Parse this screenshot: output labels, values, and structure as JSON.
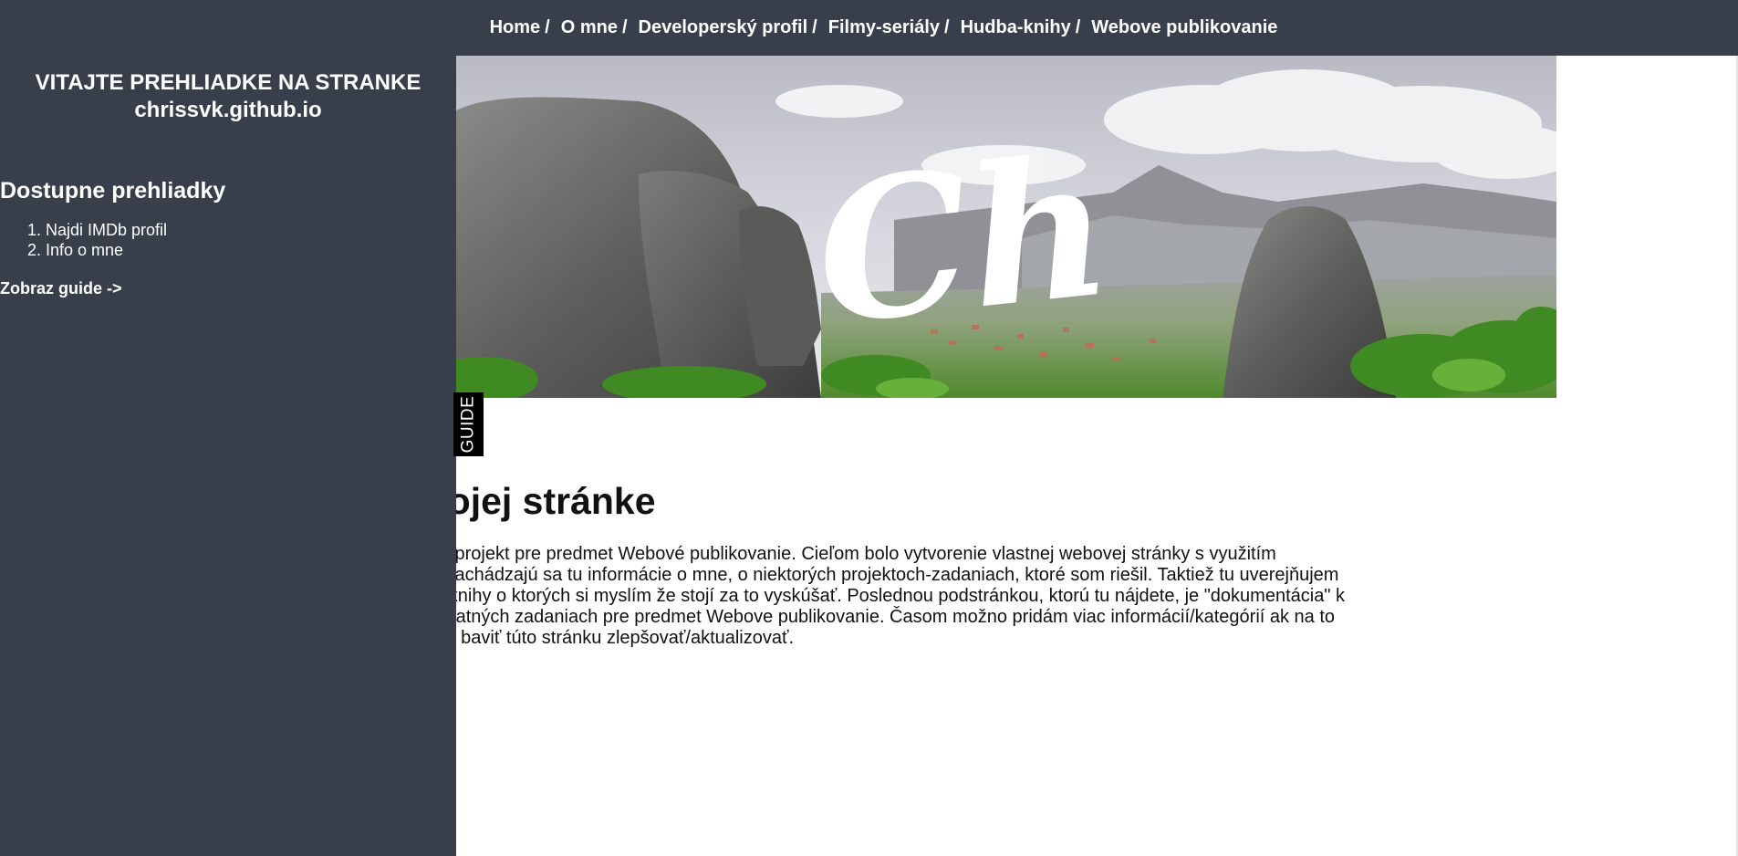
{
  "nav": {
    "items": [
      {
        "label": "Home"
      },
      {
        "label": "O mne"
      },
      {
        "label": "Developerský profil"
      },
      {
        "label": "Filmy-seriály"
      },
      {
        "label": "Hudba-knihy"
      },
      {
        "label": "Webove publikovanie"
      }
    ],
    "separator": "/"
  },
  "banner": {
    "logo_text": "Ch"
  },
  "main": {
    "heading": "a mojej stránke",
    "intro_lines": [
      "a ako projekt pre predmet Webové publikovanie. Cieľom bolo vytvorenie vlastnej webovej stránky s využitím",
      "kyll. Nachádzajú sa tu informácie o mne, o niektorých projektoch-zadaniach, ktoré som riešil. Taktiež tu uverejňujem",
      "ály a knihy o ktorých si myslím že stojí za to vyskúšať. Poslednou podstránkou, ktorú tu nájdete, je \"dokumentácia\" k",
      "r a ostatných zadaniach pre predmet Webove publikovanie. Časom možno pridám viac informácií/kategórií ak na to",
      "de ma baviť túto stránku zlepšovať/aktualizovať."
    ]
  },
  "sidebar": {
    "welcome_line1": "VITAJTE PREHLIADKE NA STRANKE",
    "welcome_line2": "chrissvk.github.io",
    "tours_title": "Dostupne prehliadky",
    "tours": [
      {
        "label": "Najdi IMDb profil"
      },
      {
        "label": "Info o mne"
      }
    ],
    "show_guide": "Zobraz guide ->"
  },
  "guide_tab": {
    "label": "GUIDE"
  },
  "colors": {
    "nav_bg": "#393e4b",
    "sidebar_bg": "#393e4b",
    "guide_tab_bg": "#000000",
    "text": "#111111"
  }
}
